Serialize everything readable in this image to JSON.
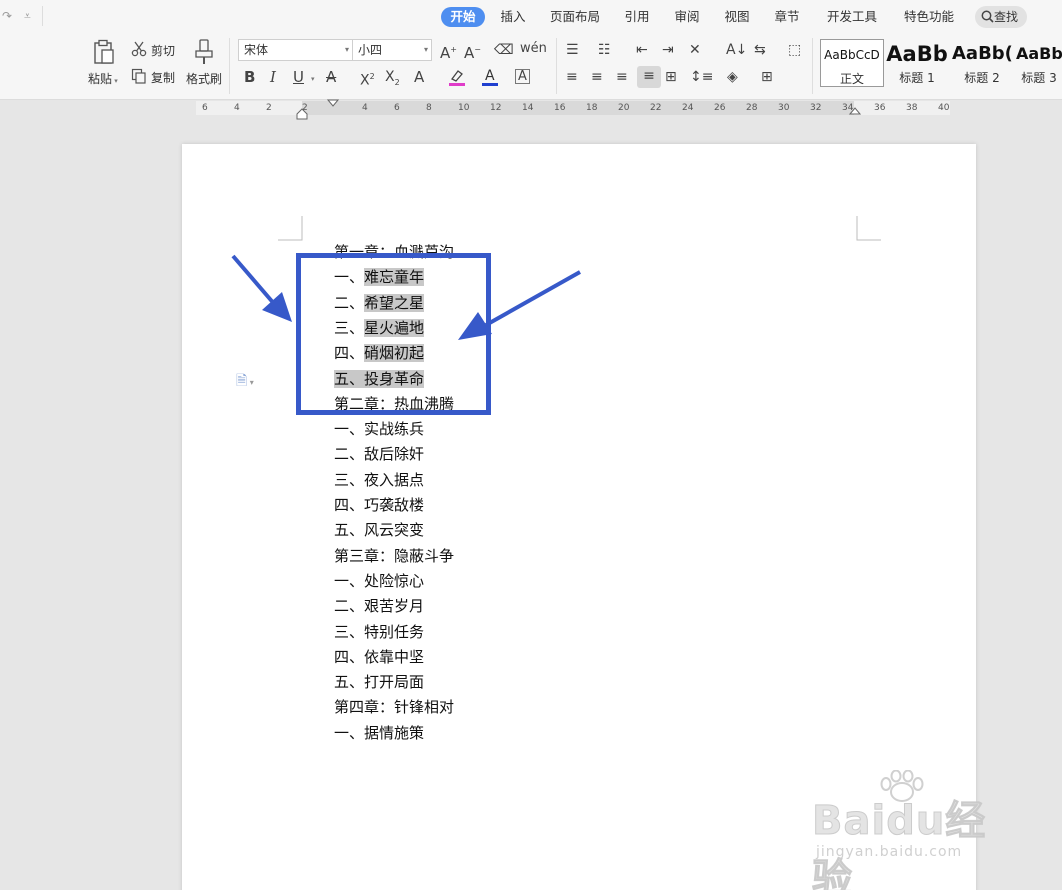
{
  "quick_access": {
    "redo": "↷",
    "more": "⩡"
  },
  "menu": {
    "tabs": [
      {
        "label": "开始",
        "active": true
      },
      {
        "label": "插入"
      },
      {
        "label": "页面布局"
      },
      {
        "label": "引用"
      },
      {
        "label": "审阅"
      },
      {
        "label": "视图"
      },
      {
        "label": "章节"
      },
      {
        "label": "开发工具"
      },
      {
        "label": "特色功能"
      }
    ],
    "search_label": "查找"
  },
  "ribbon": {
    "paste_label": "粘贴",
    "cut_label": "剪切",
    "copy_label": "复制",
    "format_painter_label": "格式刷",
    "font_name": "宋体",
    "font_size": "小四",
    "styles": [
      {
        "sample": "AaBbCcD",
        "name": "正文",
        "selected": true
      },
      {
        "sample": "AaBb",
        "name": "标题 1"
      },
      {
        "sample": "AaBb(",
        "name": "标题 2"
      },
      {
        "sample": "AaBb",
        "name": "标题 3"
      }
    ],
    "colors": {
      "highlight": "#e03cc9",
      "font_color": "#1f3fcf"
    }
  },
  "ruler": {
    "labels": [
      "6",
      "4",
      "2",
      "2",
      "4",
      "6",
      "8",
      "10",
      "12",
      "14",
      "16",
      "18",
      "20",
      "22",
      "24",
      "26",
      "28",
      "30",
      "32",
      "34",
      "36",
      "38",
      "40"
    ]
  },
  "document": {
    "lines": [
      {
        "text": "第一章：血溅芦沟"
      },
      {
        "prefix": "一、",
        "text": "难忘童年",
        "highlight": true
      },
      {
        "prefix": "二、",
        "text": "希望之星",
        "highlight": true
      },
      {
        "prefix": "三、",
        "text": "星火遍地",
        "highlight": true
      },
      {
        "prefix": "四、",
        "text": "硝烟初起",
        "highlight": true
      },
      {
        "text": "五、投身革命",
        "highlight_full": true
      },
      {
        "text": "第二章：热血沸腾"
      },
      {
        "text": "一、实战练兵"
      },
      {
        "text": "二、敌后除奸"
      },
      {
        "text": "三、夜入据点"
      },
      {
        "text": "四、巧袭敌楼"
      },
      {
        "text": "五、风云突变"
      },
      {
        "text": "第三章：隐蔽斗争"
      },
      {
        "text": "一、处险惊心"
      },
      {
        "text": "二、艰苦岁月"
      },
      {
        "text": "三、特别任务"
      },
      {
        "text": "四、依靠中坚"
      },
      {
        "text": "五、打开局面"
      },
      {
        "text": "第四章：针锋相对"
      },
      {
        "text": "一、据情施策"
      }
    ]
  },
  "annotation": {
    "color": "#3759c9"
  },
  "watermark": {
    "brand": "Baidu经验",
    "url": "jingyan.baidu.com"
  }
}
